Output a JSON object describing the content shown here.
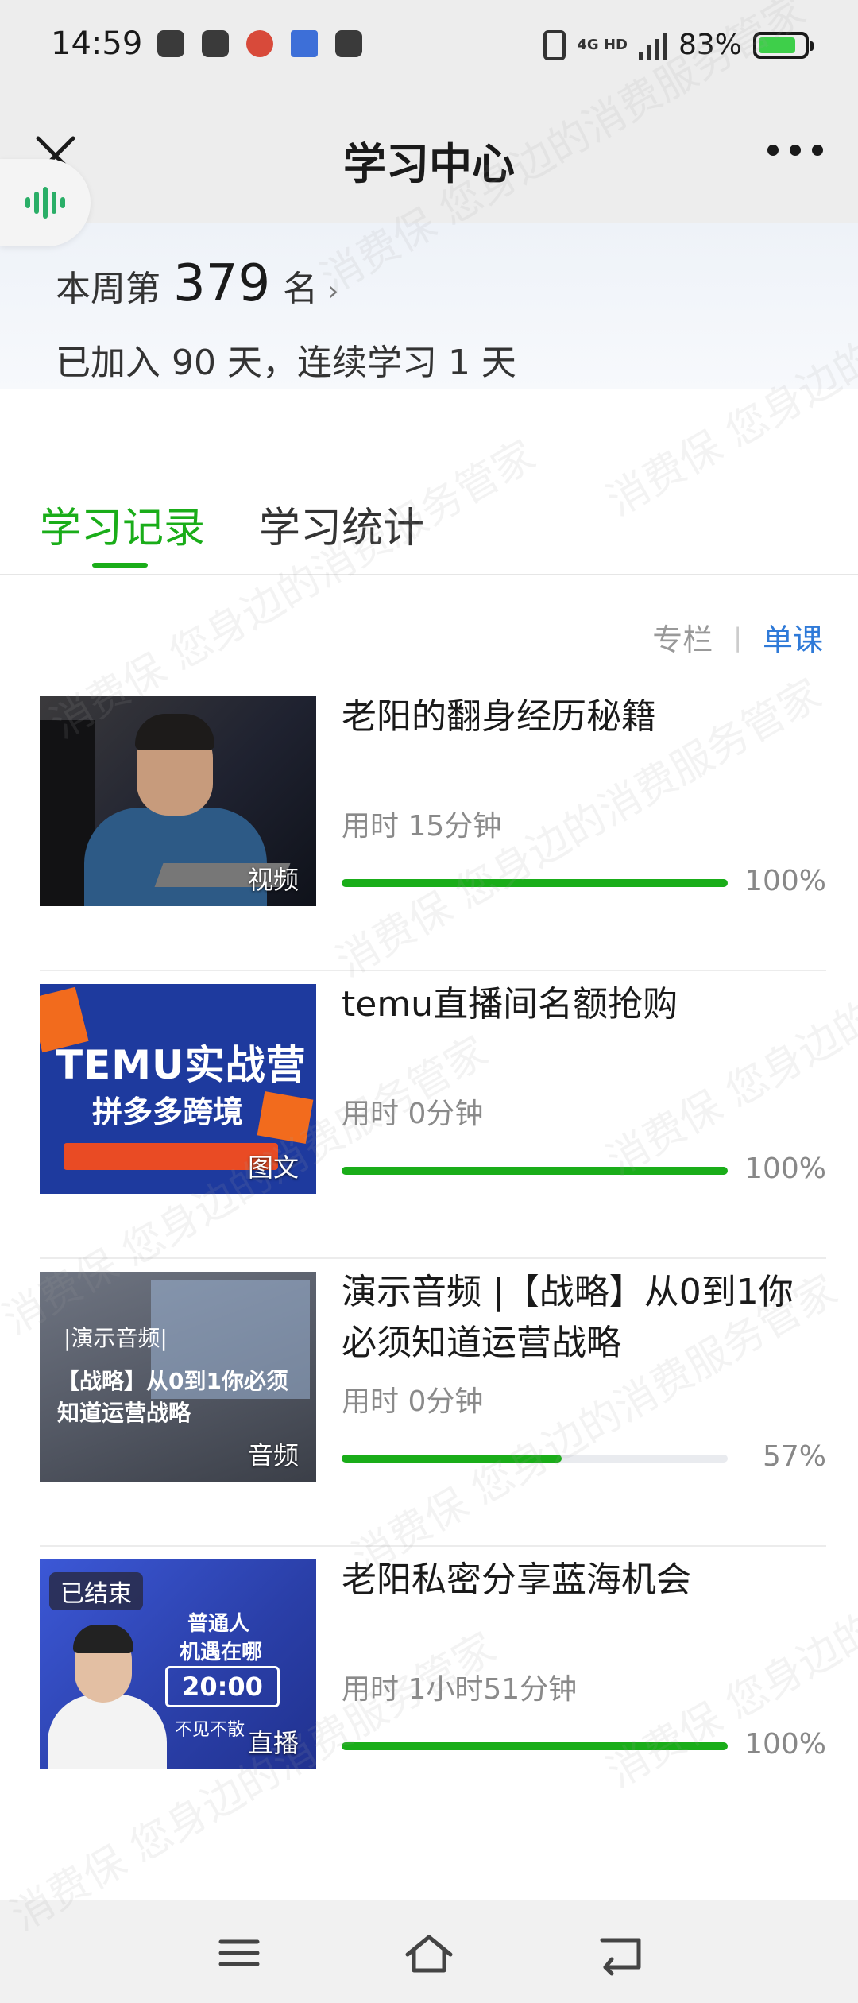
{
  "status_bar": {
    "time": "14:59",
    "network": "4G HD",
    "battery_percent": "83%",
    "battery_level": 0.83,
    "app_icons": [
      "music-icon",
      "wechat-icon",
      "maps-icon",
      "app-icon",
      "clock-app-icon"
    ]
  },
  "header": {
    "title": "学习中心",
    "close_icon": "close-icon",
    "more_icon": "more-icon"
  },
  "summary": {
    "rank_prefix": "本周第",
    "rank_number": "379",
    "rank_suffix": "名",
    "rank_chevron": "›",
    "joined_text": "已加入 90 天，连续学习 1 天"
  },
  "tabs": [
    {
      "label": "学习记录",
      "active": true
    },
    {
      "label": "学习统计",
      "active": false
    }
  ],
  "filter": {
    "column_label": "专栏",
    "divider": "|",
    "single_label": "单课",
    "active": "单课"
  },
  "courses": [
    {
      "title": "老阳的翻身经历秘籍",
      "type_label": "视频",
      "duration": "用时 15分钟",
      "progress": 1.0,
      "progress_text": "100%"
    },
    {
      "title": "temu直播间名额抢购",
      "type_label": "图文",
      "duration": "用时 0分钟",
      "progress": 1.0,
      "progress_text": "100%",
      "thumb_text": [
        "TEMU实战营",
        "拼多多跨境"
      ]
    },
    {
      "title": "演示音频 |【战略】从0到1你必须知道运营战略",
      "type_label": "音频",
      "duration": "用时 0分钟",
      "progress": 0.57,
      "progress_text": "57%",
      "thumb_text": [
        "|演示音频|",
        "【战略】从0到1你必须知道运营战略"
      ]
    },
    {
      "title": "老阳私密分享蓝海机会",
      "type_label": "直播",
      "status_badge": "已结束",
      "duration": "用时 1小时51分钟",
      "progress": 1.0,
      "progress_text": "100%",
      "thumb_text": [
        "普通人",
        "机遇在哪",
        "20:00",
        "不见不散"
      ]
    }
  ],
  "watermark_text": "消费保 您身边的消费服务管家",
  "bottom_nav": [
    "menu-icon",
    "home-icon",
    "back-icon"
  ],
  "colors": {
    "accent_green": "#1aad19",
    "link_blue": "#2f7ad8",
    "battery_green": "#3ecf4a"
  }
}
